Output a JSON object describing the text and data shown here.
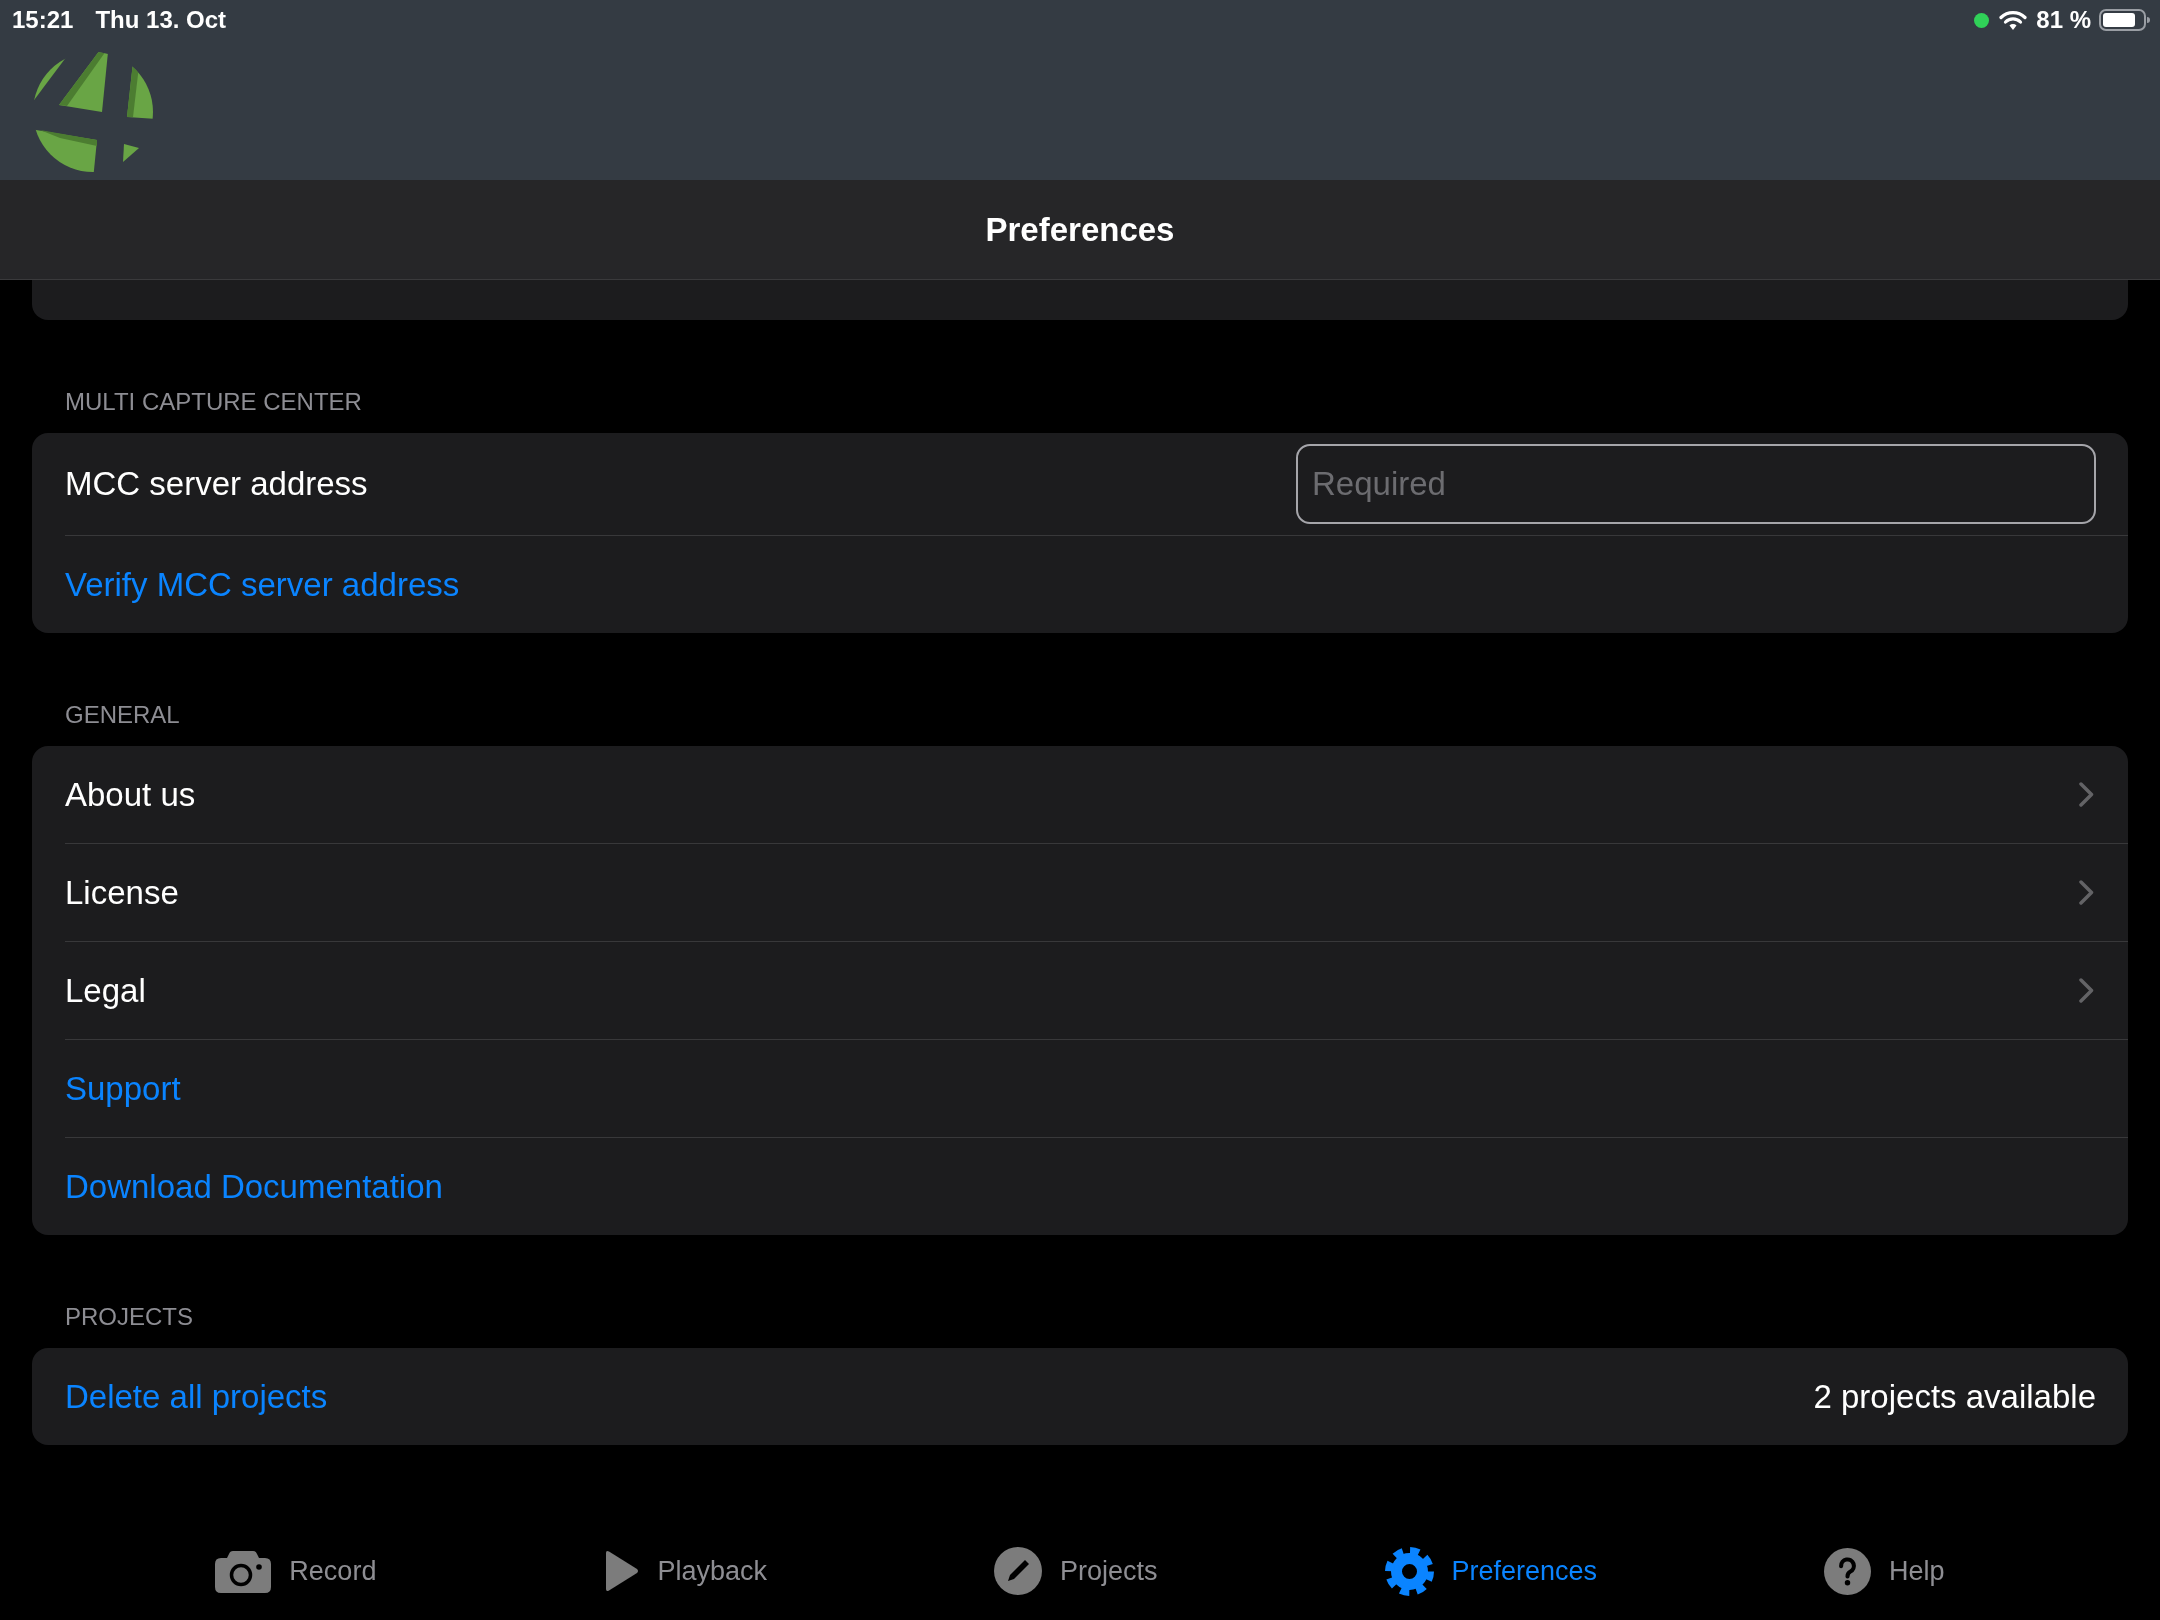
{
  "status_bar": {
    "time": "15:21",
    "date": "Thu 13. Oct",
    "battery": "81 %"
  },
  "navigation_bar": {
    "title": "Preferences"
  },
  "sections": [
    {
      "title": "MULTI CAPTURE CENTER",
      "rows": [
        {
          "kind": "field",
          "label": "MCC server address",
          "placeholder": "Required"
        },
        {
          "kind": "link",
          "label": "Verify MCC server address"
        }
      ]
    },
    {
      "title": "GENERAL",
      "rows": [
        {
          "kind": "nav",
          "label": "About us"
        },
        {
          "kind": "nav",
          "label": "License"
        },
        {
          "kind": "nav",
          "label": "Legal"
        },
        {
          "kind": "link",
          "label": "Support"
        },
        {
          "kind": "link",
          "label": "Download Documentation"
        }
      ]
    },
    {
      "title": "PROJECTS",
      "rows": [
        {
          "kind": "link_value",
          "label": "Delete all projects",
          "value": "2 projects available"
        }
      ]
    }
  ],
  "tab_bar": {
    "tabs": [
      {
        "label": "Record",
        "selected": false
      },
      {
        "label": "Playback",
        "selected": false
      },
      {
        "label": "Projects",
        "selected": false
      },
      {
        "label": "Preferences",
        "selected": true
      },
      {
        "label": "Help",
        "selected": false
      }
    ]
  }
}
